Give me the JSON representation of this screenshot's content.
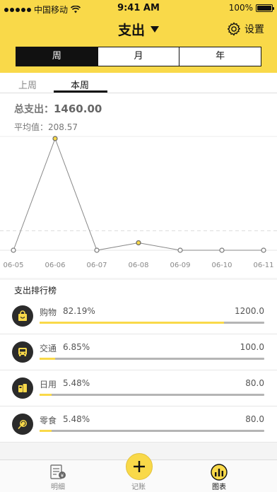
{
  "status": {
    "carrier": "中国移动",
    "time": "9:41 AM",
    "battery": "100%"
  },
  "header": {
    "title": "支出",
    "settings_label": "设置"
  },
  "period_tabs": [
    {
      "label": "周",
      "active": true
    },
    {
      "label": "月",
      "active": false
    },
    {
      "label": "年",
      "active": false
    }
  ],
  "sub_tabs": [
    {
      "label": "上周",
      "active": false
    },
    {
      "label": "本周",
      "active": true
    }
  ],
  "summary": {
    "total_label": "总支出：",
    "total_value": "1460.00",
    "avg_label": "平均值：",
    "avg_value": "208.57"
  },
  "chart_data": {
    "type": "line",
    "categories": [
      "06-05",
      "06-06",
      "06-07",
      "06-08",
      "06-09",
      "06-10",
      "06-11"
    ],
    "values": [
      0,
      1200,
      0,
      80,
      0,
      0,
      0
    ],
    "average": 208.57,
    "highlighted_points": [
      1,
      3
    ],
    "ylim": [
      0,
      1200
    ],
    "grid": false,
    "colors": {
      "line": "#888888",
      "point_fill": "#ffffff",
      "highlight": "#f9d949",
      "avg_line": "#dddddd"
    }
  },
  "ranking": {
    "title": "支出排行榜",
    "items": [
      {
        "name": "购物",
        "percent": "82.19%",
        "amount": "1200.0",
        "ratio": 0.8219,
        "icon": "shopping-bag-icon"
      },
      {
        "name": "交通",
        "percent": "6.85%",
        "amount": "100.0",
        "ratio": 0.0685,
        "icon": "bus-icon"
      },
      {
        "name": "日用",
        "percent": "5.48%",
        "amount": "80.0",
        "ratio": 0.0548,
        "icon": "daily-goods-icon"
      },
      {
        "name": "零食",
        "percent": "5.48%",
        "amount": "80.0",
        "ratio": 0.0548,
        "icon": "lollipop-icon"
      }
    ]
  },
  "tabbar": [
    {
      "label": "明细",
      "icon": "ledger-icon",
      "active": false
    },
    {
      "label": "记账",
      "icon": "plus-icon",
      "active": false
    },
    {
      "label": "图表",
      "icon": "chart-icon",
      "active": true
    }
  ],
  "colors": {
    "accent": "#f9d949",
    "dark": "#111111"
  }
}
